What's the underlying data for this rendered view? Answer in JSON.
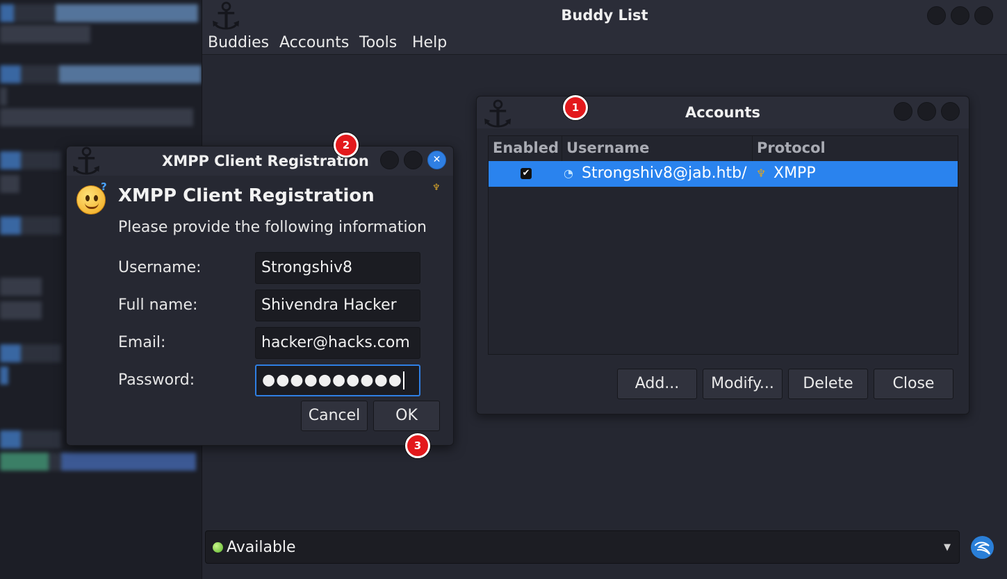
{
  "buddy_list": {
    "title": "Buddy List",
    "menu": [
      "Buddies",
      "Accounts",
      "Tools",
      "Help"
    ],
    "status": {
      "text": "Available",
      "color": "#5bb52b"
    }
  },
  "accounts_dialog": {
    "title": "Accounts",
    "columns": [
      "Enabled",
      "Username",
      "Protocol"
    ],
    "rows": [
      {
        "enabled": true,
        "username": "Strongshiv8@jab.htb/",
        "protocol": "XMPP"
      }
    ],
    "buttons": {
      "add": "Add...",
      "modify": "Modify...",
      "delete": "Delete",
      "close": "Close"
    }
  },
  "xmpp_dialog": {
    "title": "XMPP Client Registration",
    "heading": "XMPP Client Registration",
    "subtitle": "Please provide the following information",
    "fields": {
      "username": {
        "label": "Username:",
        "value": "Strongshiv8"
      },
      "full_name": {
        "label": "Full name:",
        "value": "Shivendra Hacker"
      },
      "email": {
        "label": "Email:",
        "value": "hacker@hacks.com"
      },
      "password": {
        "label": "Password:",
        "value": "●●●●●●●●●●"
      }
    },
    "buttons": {
      "cancel": "Cancel",
      "ok": "OK"
    }
  },
  "markers": [
    "1",
    "2",
    "3"
  ],
  "colors": {
    "accent": "#2a83ee",
    "marker": "#e3191c"
  }
}
